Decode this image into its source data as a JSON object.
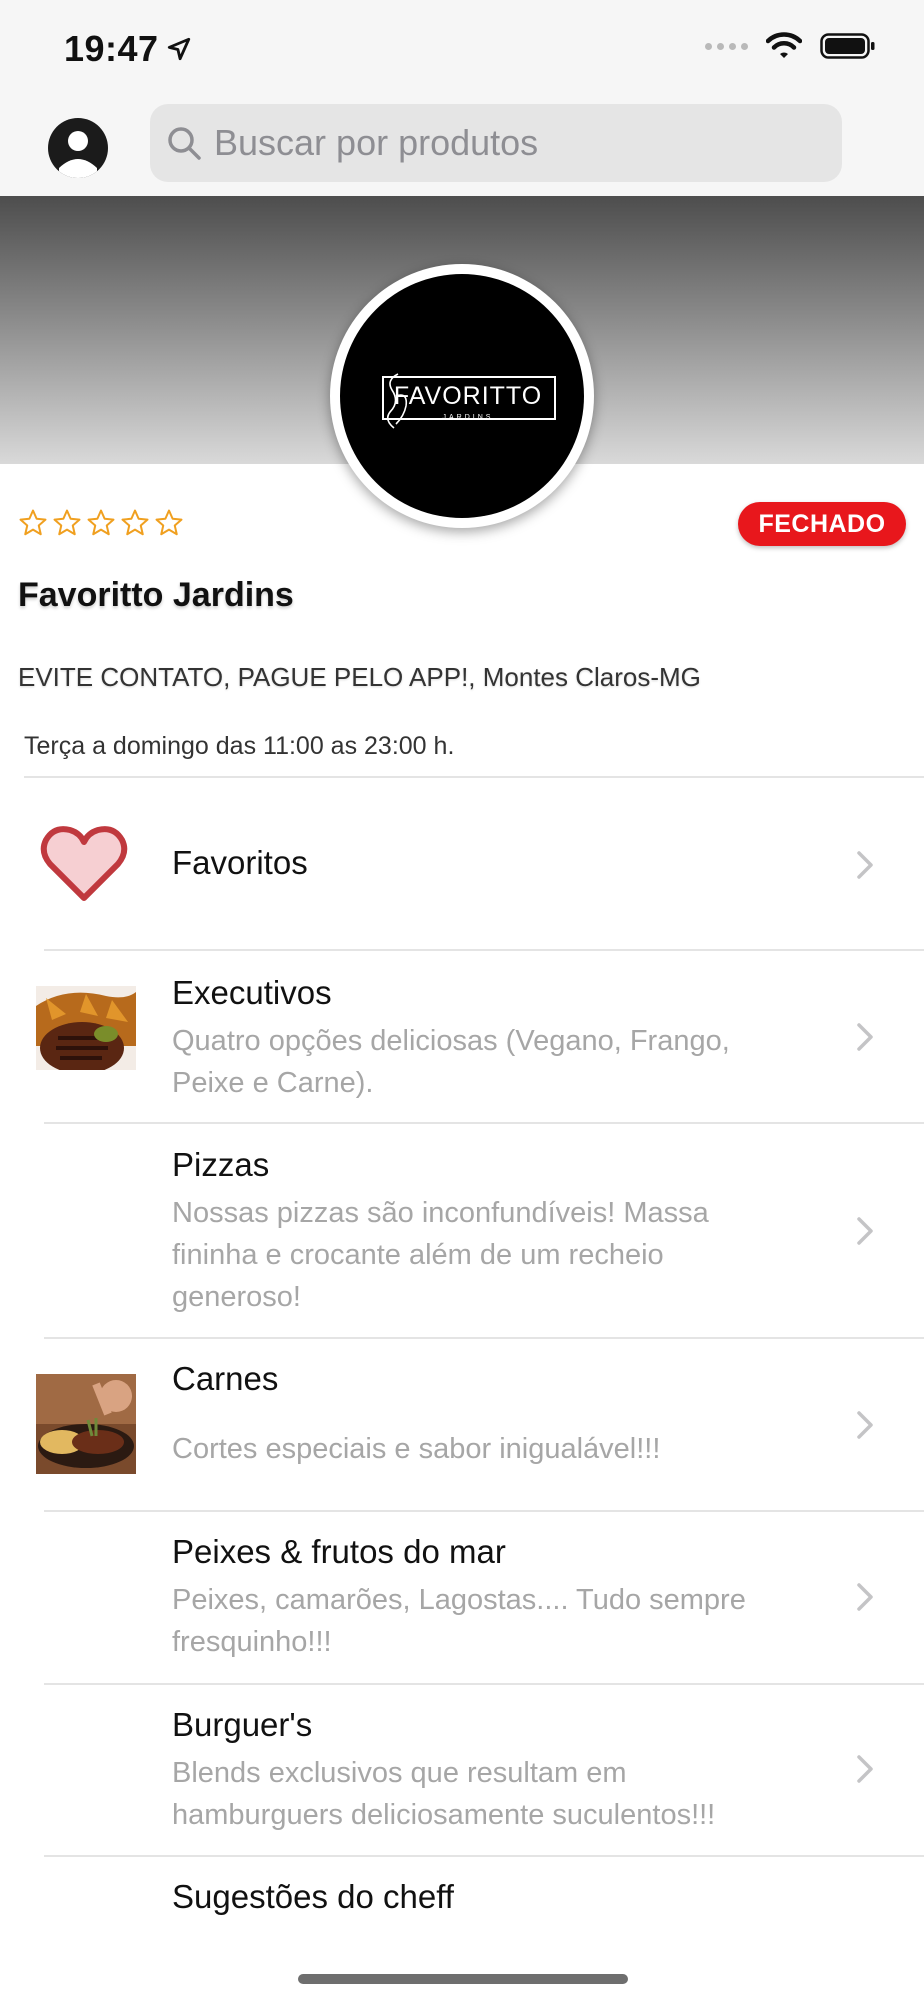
{
  "status_bar": {
    "time": "19:47"
  },
  "search": {
    "placeholder": "Buscar por produtos"
  },
  "store": {
    "logo_name": "FAVORITTO",
    "logo_sub": "JARDINS",
    "rating": 0,
    "max_rating": 5,
    "status_badge": "FECHADO",
    "name": "Favoritto Jardins",
    "address": "EVITE CONTATO, PAGUE PELO APP!, Montes Claros-MG",
    "hours": "Terça a domingo das 11:00 as 23:00 h."
  },
  "categories": [
    {
      "title": "Favoritos",
      "description": "",
      "icon": "heart-icon"
    },
    {
      "title": "Executivos",
      "description": "Quatro opções deliciosas (Vegano, Frango, Peixe e Carne).",
      "thumbnail": "steak-plate-image"
    },
    {
      "title": "Pizzas",
      "description": "Nossas pizzas são inconfundíveis! Massa fininha e crocante além de um recheio generoso!"
    },
    {
      "title": "Carnes",
      "description": "Cortes especiais e sabor inigualável!!!",
      "thumbnail": "grilled-meat-image"
    },
    {
      "title": "Peixes & frutos do mar",
      "description": "Peixes, camarões, Lagostas.... Tudo sempre fresquinho!!!"
    },
    {
      "title": "Burguer's",
      "description": "Blends exclusivos que resultam em hamburguers deliciosamente suculentos!!!"
    },
    {
      "title": "Sugestões do cheff",
      "description": ""
    }
  ],
  "colors": {
    "badge": "#e8171c",
    "star": "#f0a020",
    "heart": "#c0393e"
  }
}
